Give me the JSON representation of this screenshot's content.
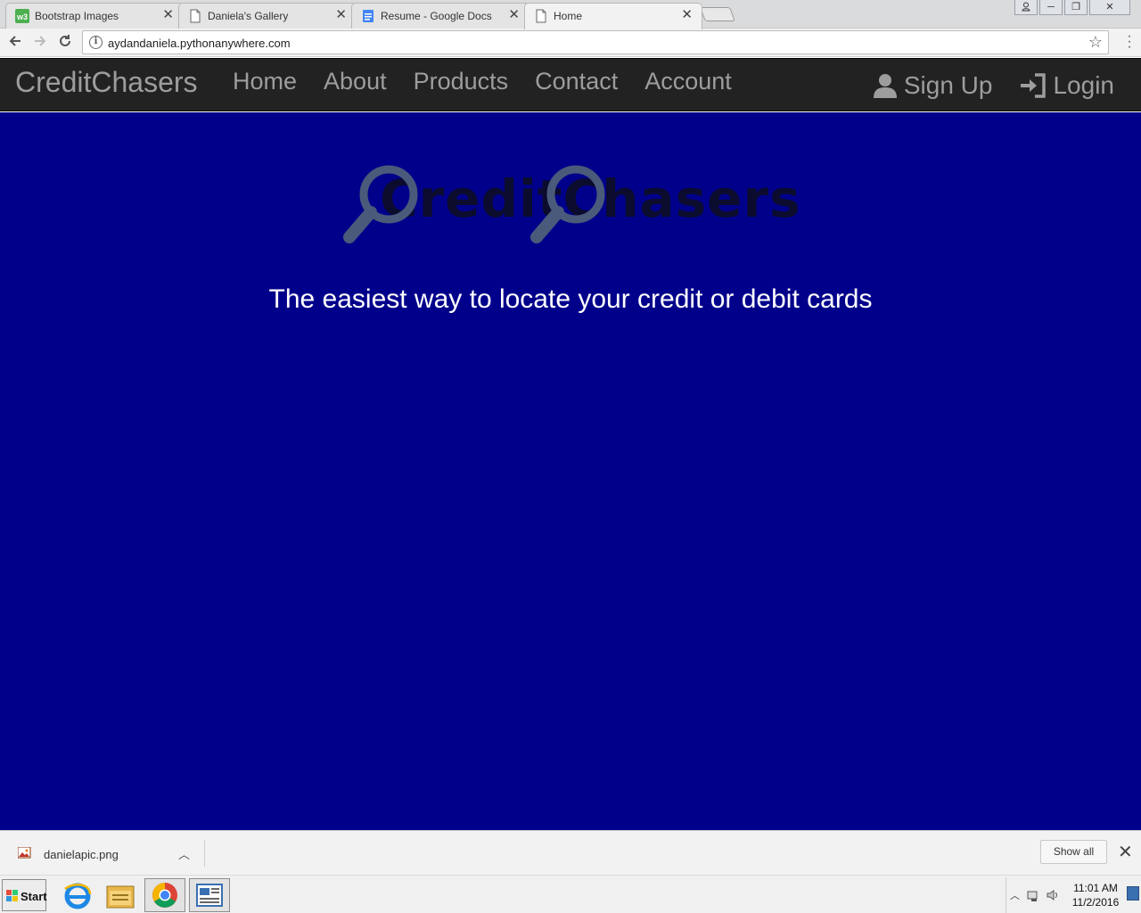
{
  "browser": {
    "tabs": [
      {
        "title": "Bootstrap Images",
        "favicon": "w3schools-icon",
        "active": false
      },
      {
        "title": "Daniela's Gallery",
        "favicon": "page-icon",
        "active": false
      },
      {
        "title": "Resume - Google Docs",
        "favicon": "docs-icon",
        "active": false
      },
      {
        "title": "Home",
        "favicon": "page-icon",
        "active": true
      }
    ],
    "url": "aydandaniela.pythonanywhere.com"
  },
  "site": {
    "brand": "CreditChasers",
    "nav": [
      "Home",
      "About",
      "Products",
      "Contact",
      "Account"
    ],
    "signup_label": "Sign Up",
    "login_label": "Login",
    "logo_text": "CreditChasers",
    "tagline": "The easiest way to locate your credit or debit cards",
    "background_color": "#00008B"
  },
  "downloads": {
    "file": "danielapic.png",
    "show_all": "Show all"
  },
  "taskbar": {
    "start": "Start",
    "apps": [
      "internet-explorer-icon",
      "file-explorer-icon",
      "chrome-icon",
      "news-app-icon"
    ],
    "time": "11:01 AM",
    "date": "11/2/2016"
  }
}
